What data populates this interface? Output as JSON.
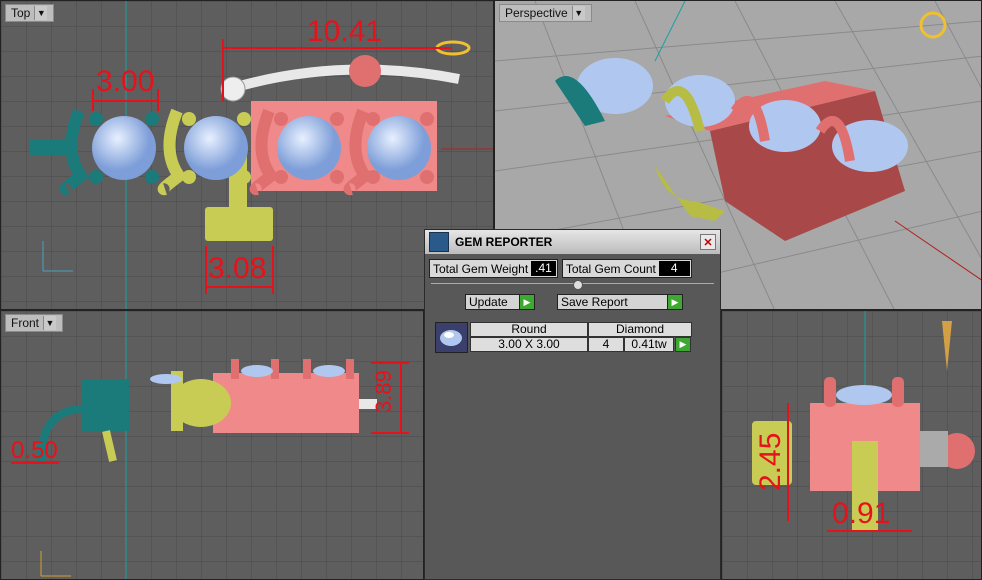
{
  "viewports": {
    "top": {
      "label": "Top",
      "dims": [
        "10.41",
        "3.00",
        "3.08"
      ]
    },
    "perspective": {
      "label": "Perspective"
    },
    "front": {
      "label": "Front",
      "dims": [
        "0.50",
        "3.89"
      ]
    },
    "right": {
      "dims": [
        "2.45",
        "0.91"
      ]
    }
  },
  "gem_reporter": {
    "title": "GEM REPORTER",
    "total_gem_weight_label": "Total Gem Weight",
    "total_gem_weight_value": ".41",
    "total_gem_count_label": "Total Gem Count",
    "total_gem_count_value": "4",
    "update_label": "Update",
    "save_report_label": "Save Report",
    "table": {
      "headers": [
        "Round",
        "Diamond"
      ],
      "row": {
        "size": "3.00 X 3.00",
        "count": "4",
        "weight": "0.41tw"
      }
    }
  },
  "colors": {
    "dimension": "#e6121b",
    "salmon": "#f08080",
    "teal": "#1b7a7a",
    "lime": "#c8cc55",
    "grid_bg": "#5e5e5e"
  },
  "icons": [
    "dropdown-arrow-icon",
    "gem-reporter-icon",
    "close-icon",
    "go-arrow-icon",
    "gem-thumbnail-icon"
  ]
}
